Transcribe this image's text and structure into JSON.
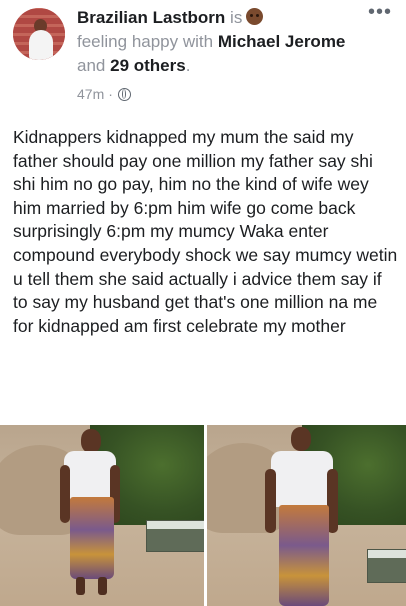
{
  "post": {
    "author": "Brazilian Lastborn",
    "is_word": "is",
    "feeling": "feeling happy with",
    "tag1": "Michael Jerome",
    "and_word": "and",
    "others": "29 others",
    "period": ".",
    "time": "47m",
    "separator": "·",
    "more_icon": "more-horizontal-icon",
    "privacy_icon": "globe-icon",
    "text": "Kidnappers kidnapped my mum the said my father should pay one million my father say shi shi him no go pay, him no the kind of wife wey him  married by 6:pm him wife go come back surprisingly 6:pm my mumcy Waka enter compound everybody shock we say mumcy wetin u tell them she said actually i advice them say if to say my husband get that's one million na me for kidnapped am first celebrate my mother"
  },
  "colors": {
    "primary_text": "#1c1e21",
    "secondary_text": "#90949c"
  }
}
